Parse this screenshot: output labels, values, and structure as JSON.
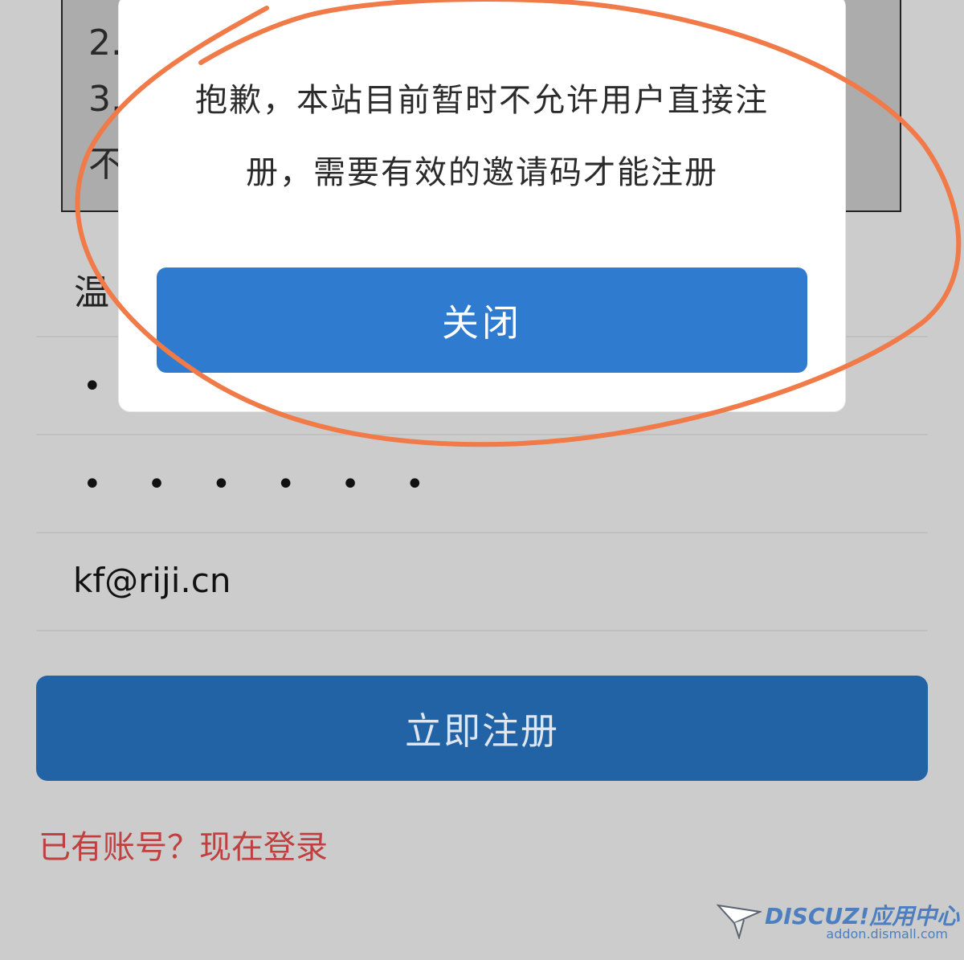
{
  "notice": {
    "line1": "2.",
    "line2": "3.",
    "line3": "不"
  },
  "tip": {
    "label": "温"
  },
  "form": {
    "username_value": "•",
    "password_value": "• • • • • •",
    "email_value": "kf@riji.cn",
    "register_label": "立即注册"
  },
  "login_link": "已有账号？现在登录",
  "modal": {
    "message": "抱歉，本站目前暂时不允许用户直接注册，需要有效的邀请码才能注册",
    "close_label": "关闭"
  },
  "watermark": {
    "brand": "DISCUZ!应用中心",
    "url": "addon.dismall.com"
  },
  "colors": {
    "page_bg": "#cccccc",
    "primary": "#2163a5",
    "modal_button": "#2e7bd0",
    "link": "#c04040",
    "annotation": "#f07a48"
  }
}
